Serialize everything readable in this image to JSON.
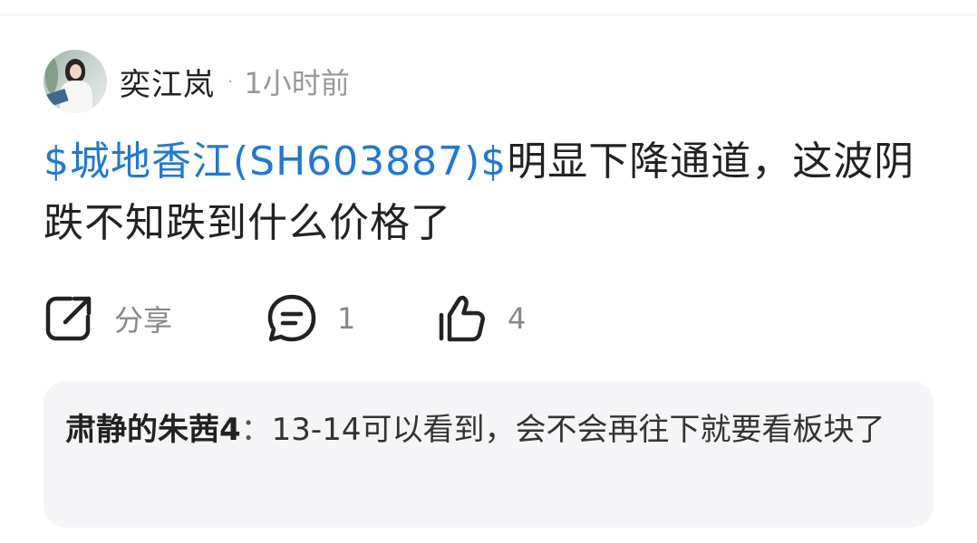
{
  "post": {
    "author": "奕江岚",
    "separator": "·",
    "time": "1小时前",
    "stock_tag": "$城地香江(SH603887)$",
    "text": "明显下降通道，这波阴跌不知跌到什么价格了"
  },
  "actions": {
    "share_label": "分享",
    "comment_count": "1",
    "like_count": "4",
    "icons": [
      "share-icon",
      "comment-icon",
      "thumbs-up-icon"
    ]
  },
  "reply": {
    "author": "肃静的朱茜4",
    "separator": "：",
    "text": "13-14可以看到，会不会再往下就要看板块了"
  },
  "colors": {
    "link": "#1e78d8",
    "reply_background": "#f5f5f7",
    "secondary_text": "#888888"
  }
}
